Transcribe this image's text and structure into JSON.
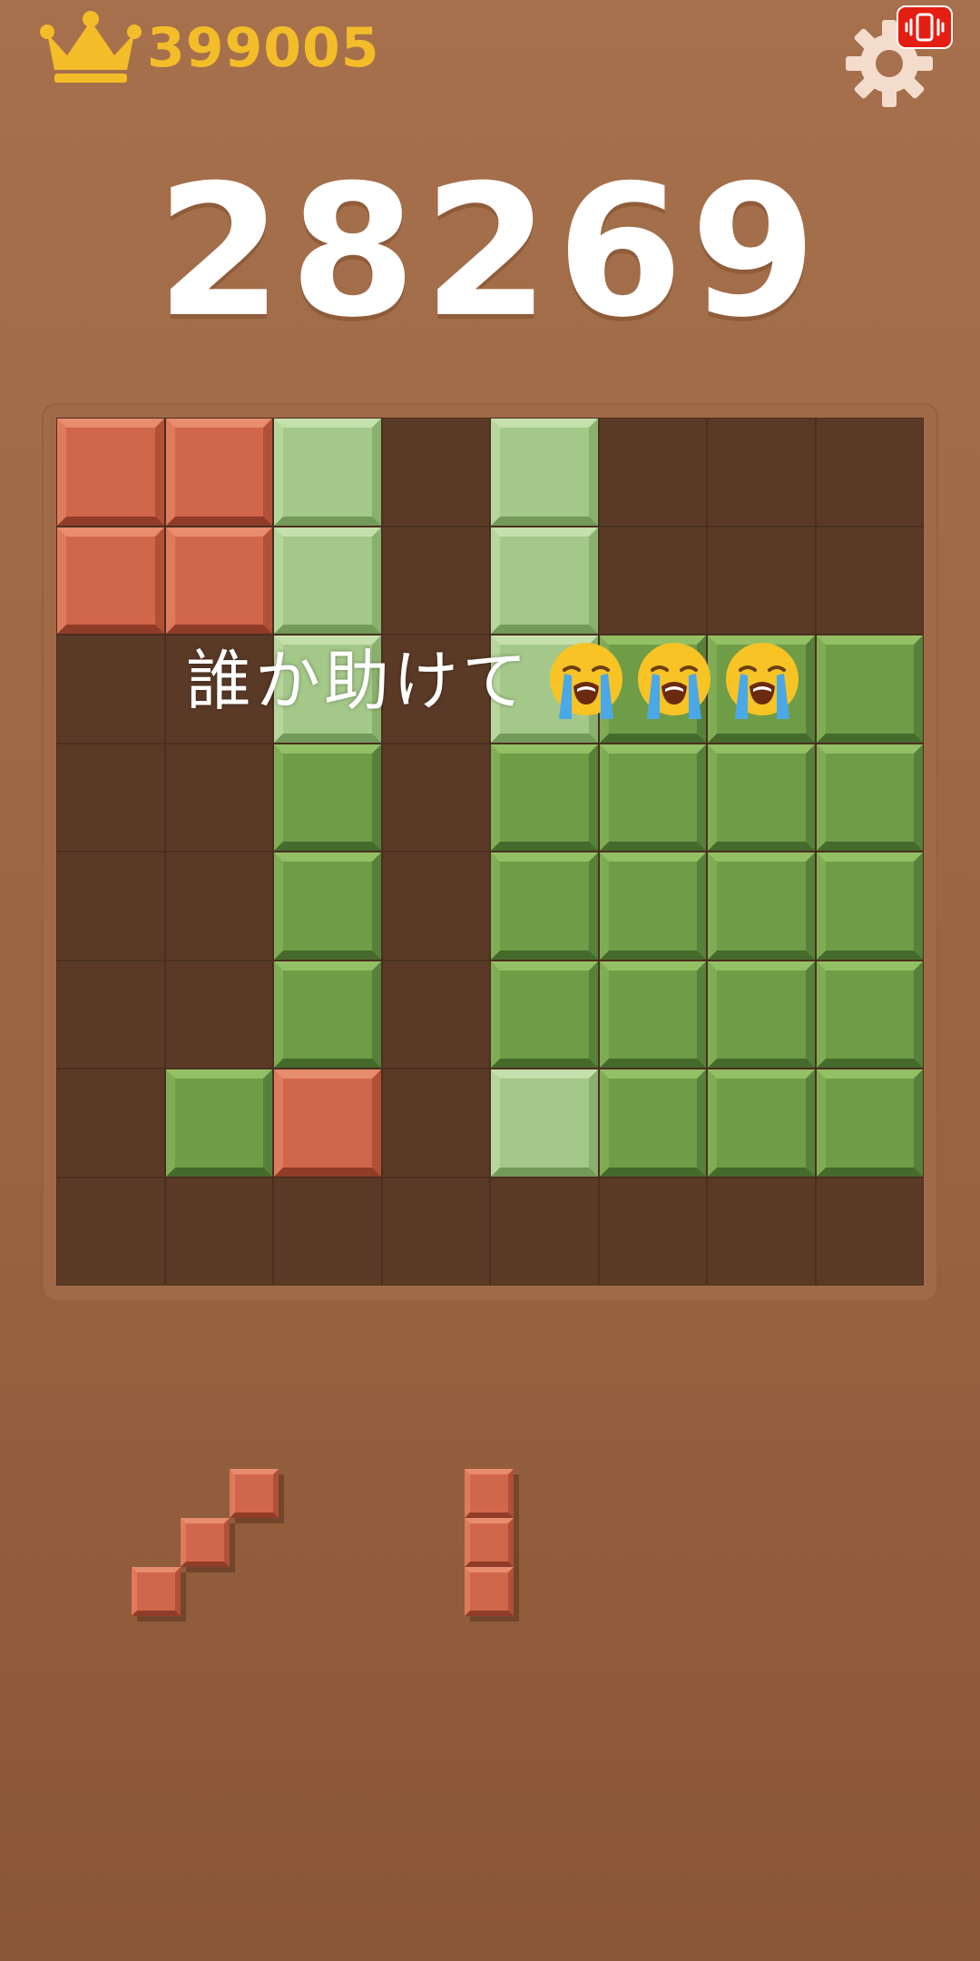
{
  "header": {
    "best_score": "399005",
    "current_score": "28269"
  },
  "icons": {
    "best": "crown-icon",
    "settings": "gear-icon",
    "vibration": "vibrate-icon",
    "emoji": "loudly-crying-face-emoji"
  },
  "overlay": {
    "caption": "誰か助けて",
    "emoji_count": 3
  },
  "board": {
    "rows": 8,
    "cols": 8,
    "grid": [
      "RRL.L...",
      "RRL.L...",
      "..L.LGGG",
      "..G.GGGG",
      "..G.GGGG",
      "..G.GGGG",
      ".GR.LGGG",
      "........"
    ],
    "legend": {
      "R": "red",
      "G": "green",
      "L": "light-green",
      ".": "empty"
    }
  },
  "tray": {
    "pieces": [
      {
        "name": "diagonal-3-red",
        "color": "red",
        "cells": [
          [
            0,
            2
          ],
          [
            1,
            1
          ],
          [
            2,
            0
          ]
        ]
      },
      {
        "name": "vertical-3-red",
        "color": "red",
        "cells": [
          [
            0,
            0
          ],
          [
            1,
            0
          ],
          [
            2,
            0
          ]
        ]
      }
    ]
  },
  "colors": {
    "background": "#a06a46",
    "board_empty": "#5a3a26",
    "red_block": "#d1674a",
    "green_block": "#6f9c46",
    "light_green_block": "#a4c889",
    "gold": "#f3bd2a",
    "badge_red": "#e41e12"
  }
}
